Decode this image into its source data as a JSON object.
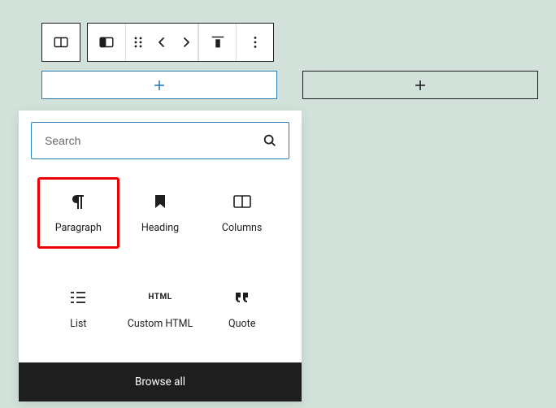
{
  "search": {
    "placeholder": "Search"
  },
  "blocks": {
    "paragraph": "Paragraph",
    "heading": "Heading",
    "columns": "Columns",
    "list": "List",
    "custom_html": "Custom HTML",
    "quote": "Quote"
  },
  "browse_all": "Browse all",
  "html_glyph": "HTML"
}
